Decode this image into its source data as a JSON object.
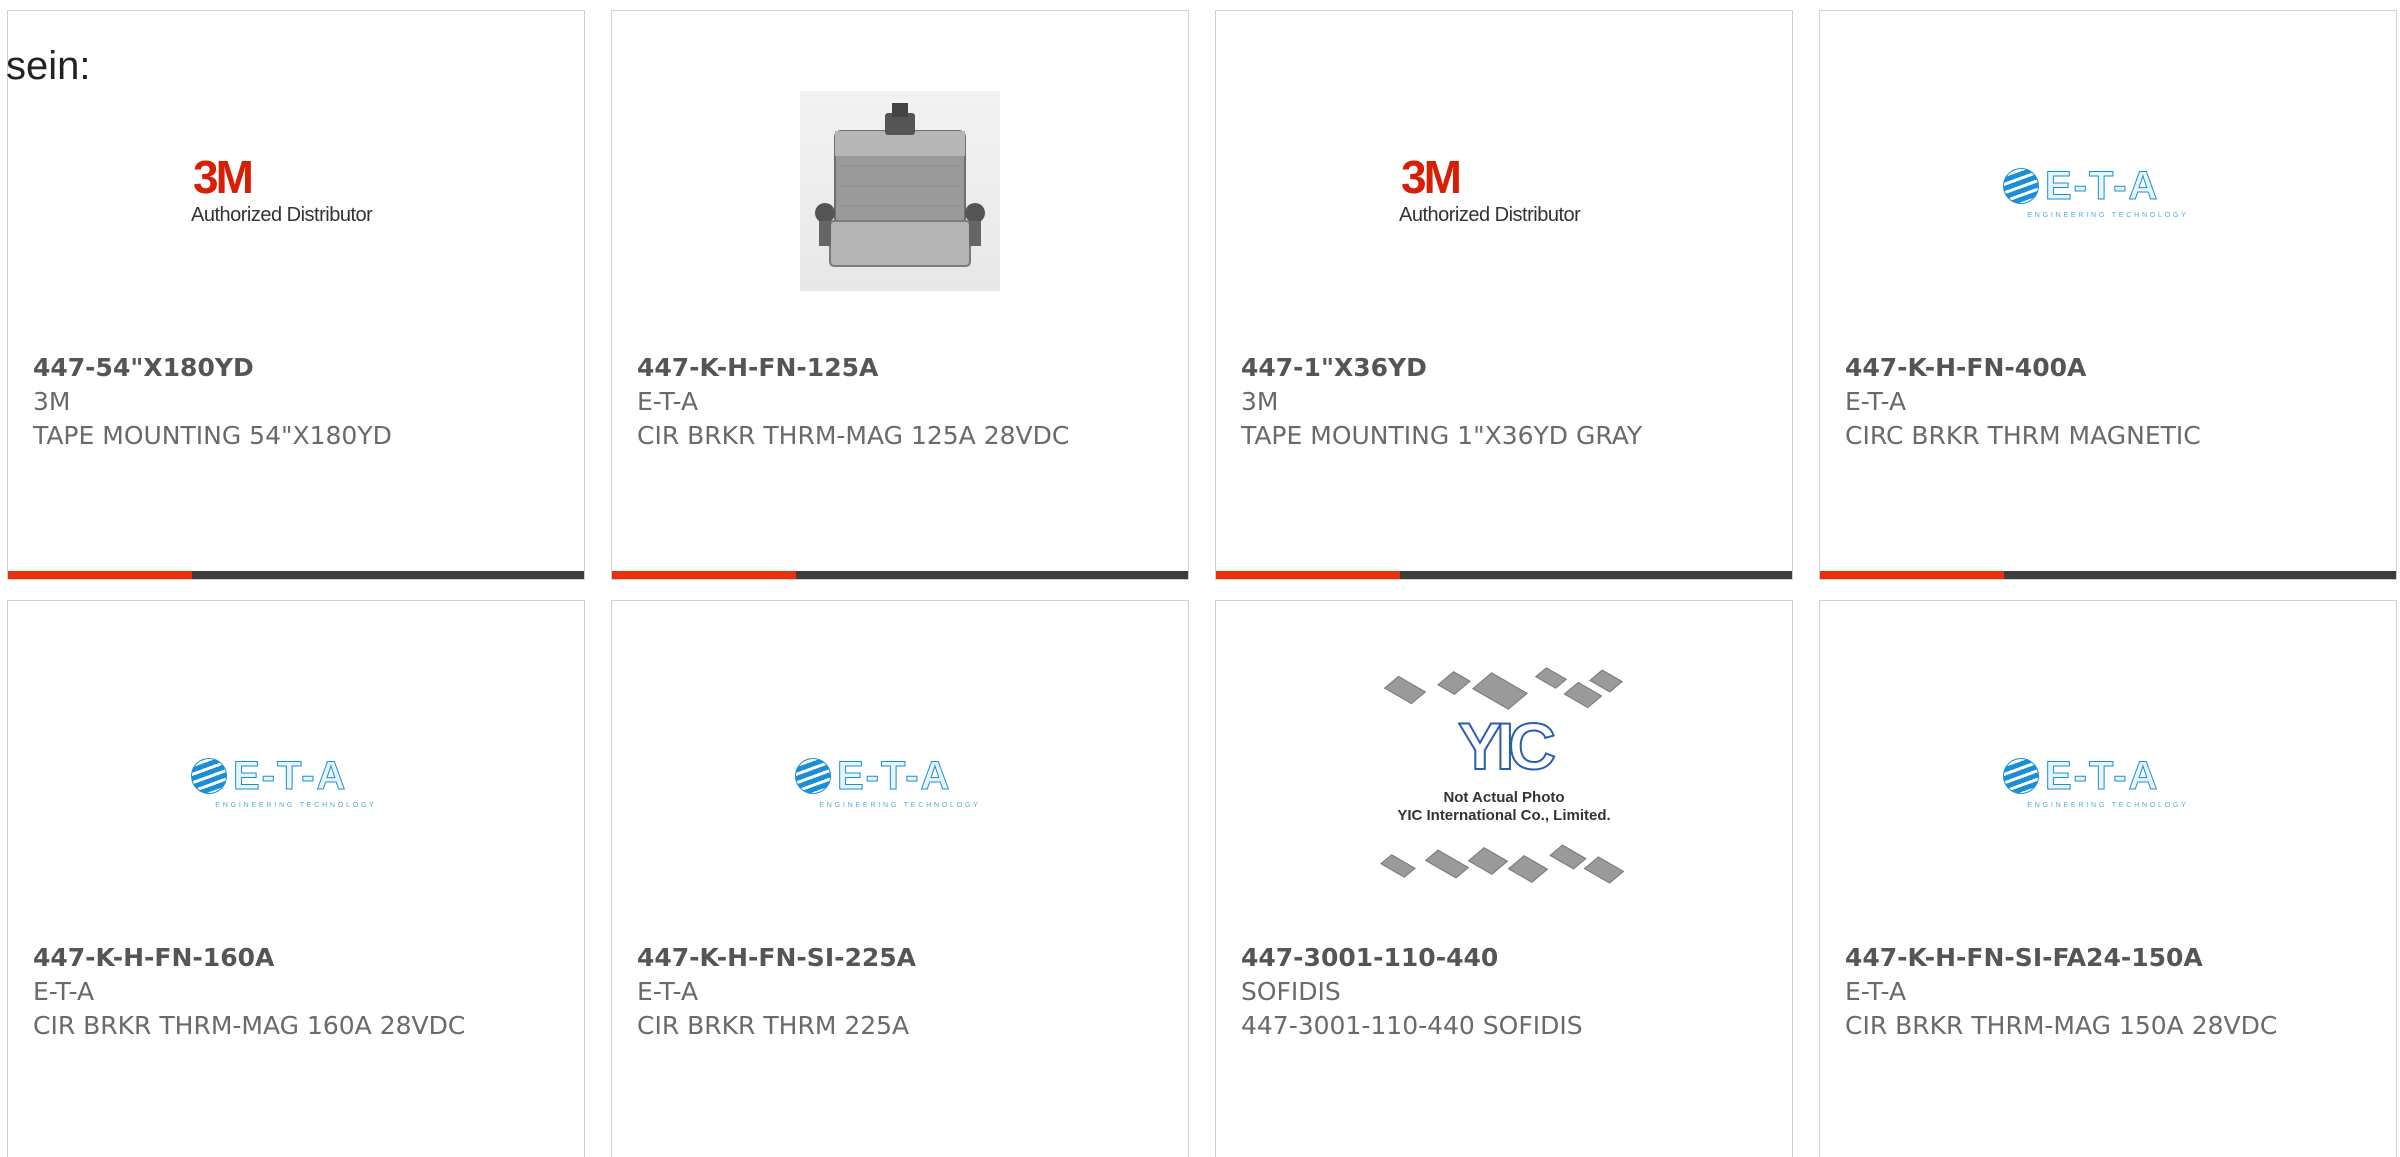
{
  "heading": "sein:",
  "colors": {
    "accent": "#e8300c",
    "bar_track": "#3d3d3d",
    "border": "#d2d2d2"
  },
  "logos": {
    "m3": {
      "mark": "3M",
      "tagline": "Authorized Distributor"
    },
    "eta": {
      "word": "E-T-A",
      "subline": "ENGINEERING TECHNOLOGY"
    },
    "yic": {
      "mark": "YIC",
      "line1": "Not Actual Photo",
      "line2": "YIC International Co., Limited."
    }
  },
  "products": [
    {
      "part_number": "447-54\"X180YD",
      "manufacturer": "3M",
      "description": "TAPE MOUNTING 54\"X180YD",
      "image": "3m-logo",
      "progress": 0.32
    },
    {
      "part_number": "447-K-H-FN-125A",
      "manufacturer": "E-T-A",
      "description": "CIR BRKR THRM-MAG 125A 28VDC",
      "image": "circuit-breaker-photo",
      "progress": 0.32
    },
    {
      "part_number": "447-1\"X36YD",
      "manufacturer": "3M",
      "description": "TAPE MOUNTING 1\"X36YD GRAY",
      "image": "3m-logo",
      "progress": 0.32
    },
    {
      "part_number": "447-K-H-FN-400A",
      "manufacturer": "E-T-A",
      "description": "CIRC BRKR THRM MAGNETIC",
      "image": "eta-logo",
      "progress": 0.32
    },
    {
      "part_number": "447-K-H-FN-160A",
      "manufacturer": "E-T-A",
      "description": "CIR BRKR THRM-MAG 160A 28VDC",
      "image": "eta-logo"
    },
    {
      "part_number": "447-K-H-FN-SI-225A",
      "manufacturer": "E-T-A",
      "description": "CIR BRKR THRM 225A",
      "image": "eta-logo"
    },
    {
      "part_number": "447-3001-110-440",
      "manufacturer": "SOFIDIS",
      "description": "447-3001-110-440 SOFIDIS",
      "image": "yic-placeholder"
    },
    {
      "part_number": "447-K-H-FN-SI-FA24-150A",
      "manufacturer": "E-T-A",
      "description": "CIR BRKR THRM-MAG 150A 28VDC",
      "image": "eta-logo"
    }
  ]
}
